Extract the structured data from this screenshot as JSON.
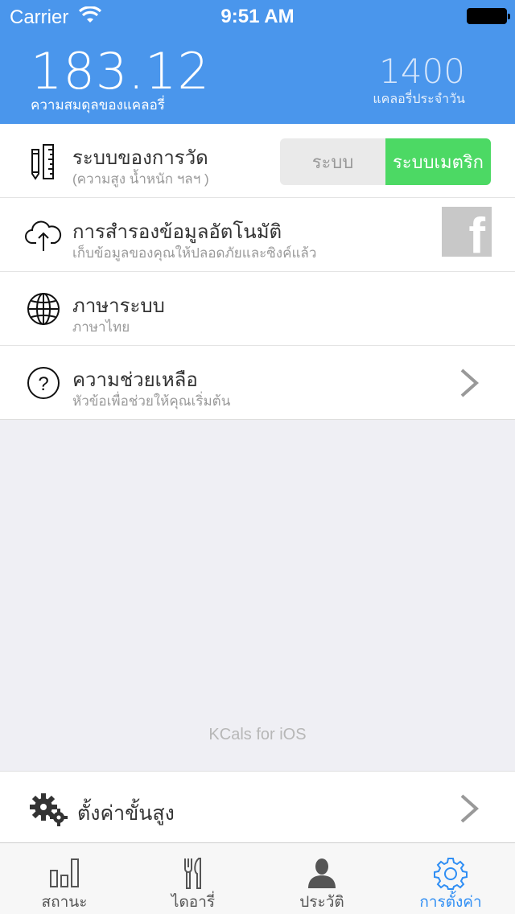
{
  "status_bar": {
    "carrier": "Carrier",
    "time": "9:51 AM"
  },
  "header": {
    "balance_value": "183.12",
    "balance_label": "ความสมดุลของแคลอรี่",
    "daily_value": "1400",
    "daily_label": "แคลอรี่ประจำวัน"
  },
  "settings": {
    "units": {
      "title": "ระบบของการวัด",
      "subtitle": "(ความสูง น้ำหนัก ฯลฯ )",
      "option_off": "ระบบ",
      "option_on": "ระบบเมตริก"
    },
    "backup": {
      "title": "การสำรองข้อมูลอัตโนมัติ",
      "subtitle": "เก็บข้อมูลของคุณให้ปลอดภัยและซิงค์แล้ว",
      "facebook_label": "f"
    },
    "language": {
      "title": "ภาษาระบบ",
      "subtitle": "ภาษาไทย"
    },
    "help": {
      "title": "ความช่วยเหลือ",
      "subtitle": "หัวข้อเพื่อช่วยให้คุณเริ่มต้น"
    }
  },
  "footer_text": "KCals for iOS",
  "advanced": {
    "title": "ตั้งค่าขั้นสูง"
  },
  "tabs": [
    {
      "label": "สถานะ",
      "icon": "bar-chart-icon"
    },
    {
      "label": "ไดอารี่",
      "icon": "fork-knife-icon"
    },
    {
      "label": "ประวัติ",
      "icon": "person-icon"
    },
    {
      "label": "การตั้งค่า",
      "icon": "gear-icon",
      "active": true
    }
  ],
  "colors": {
    "header": "#4a96ec",
    "toggle_on": "#4cd964",
    "tab_active": "#2f8ef4"
  }
}
